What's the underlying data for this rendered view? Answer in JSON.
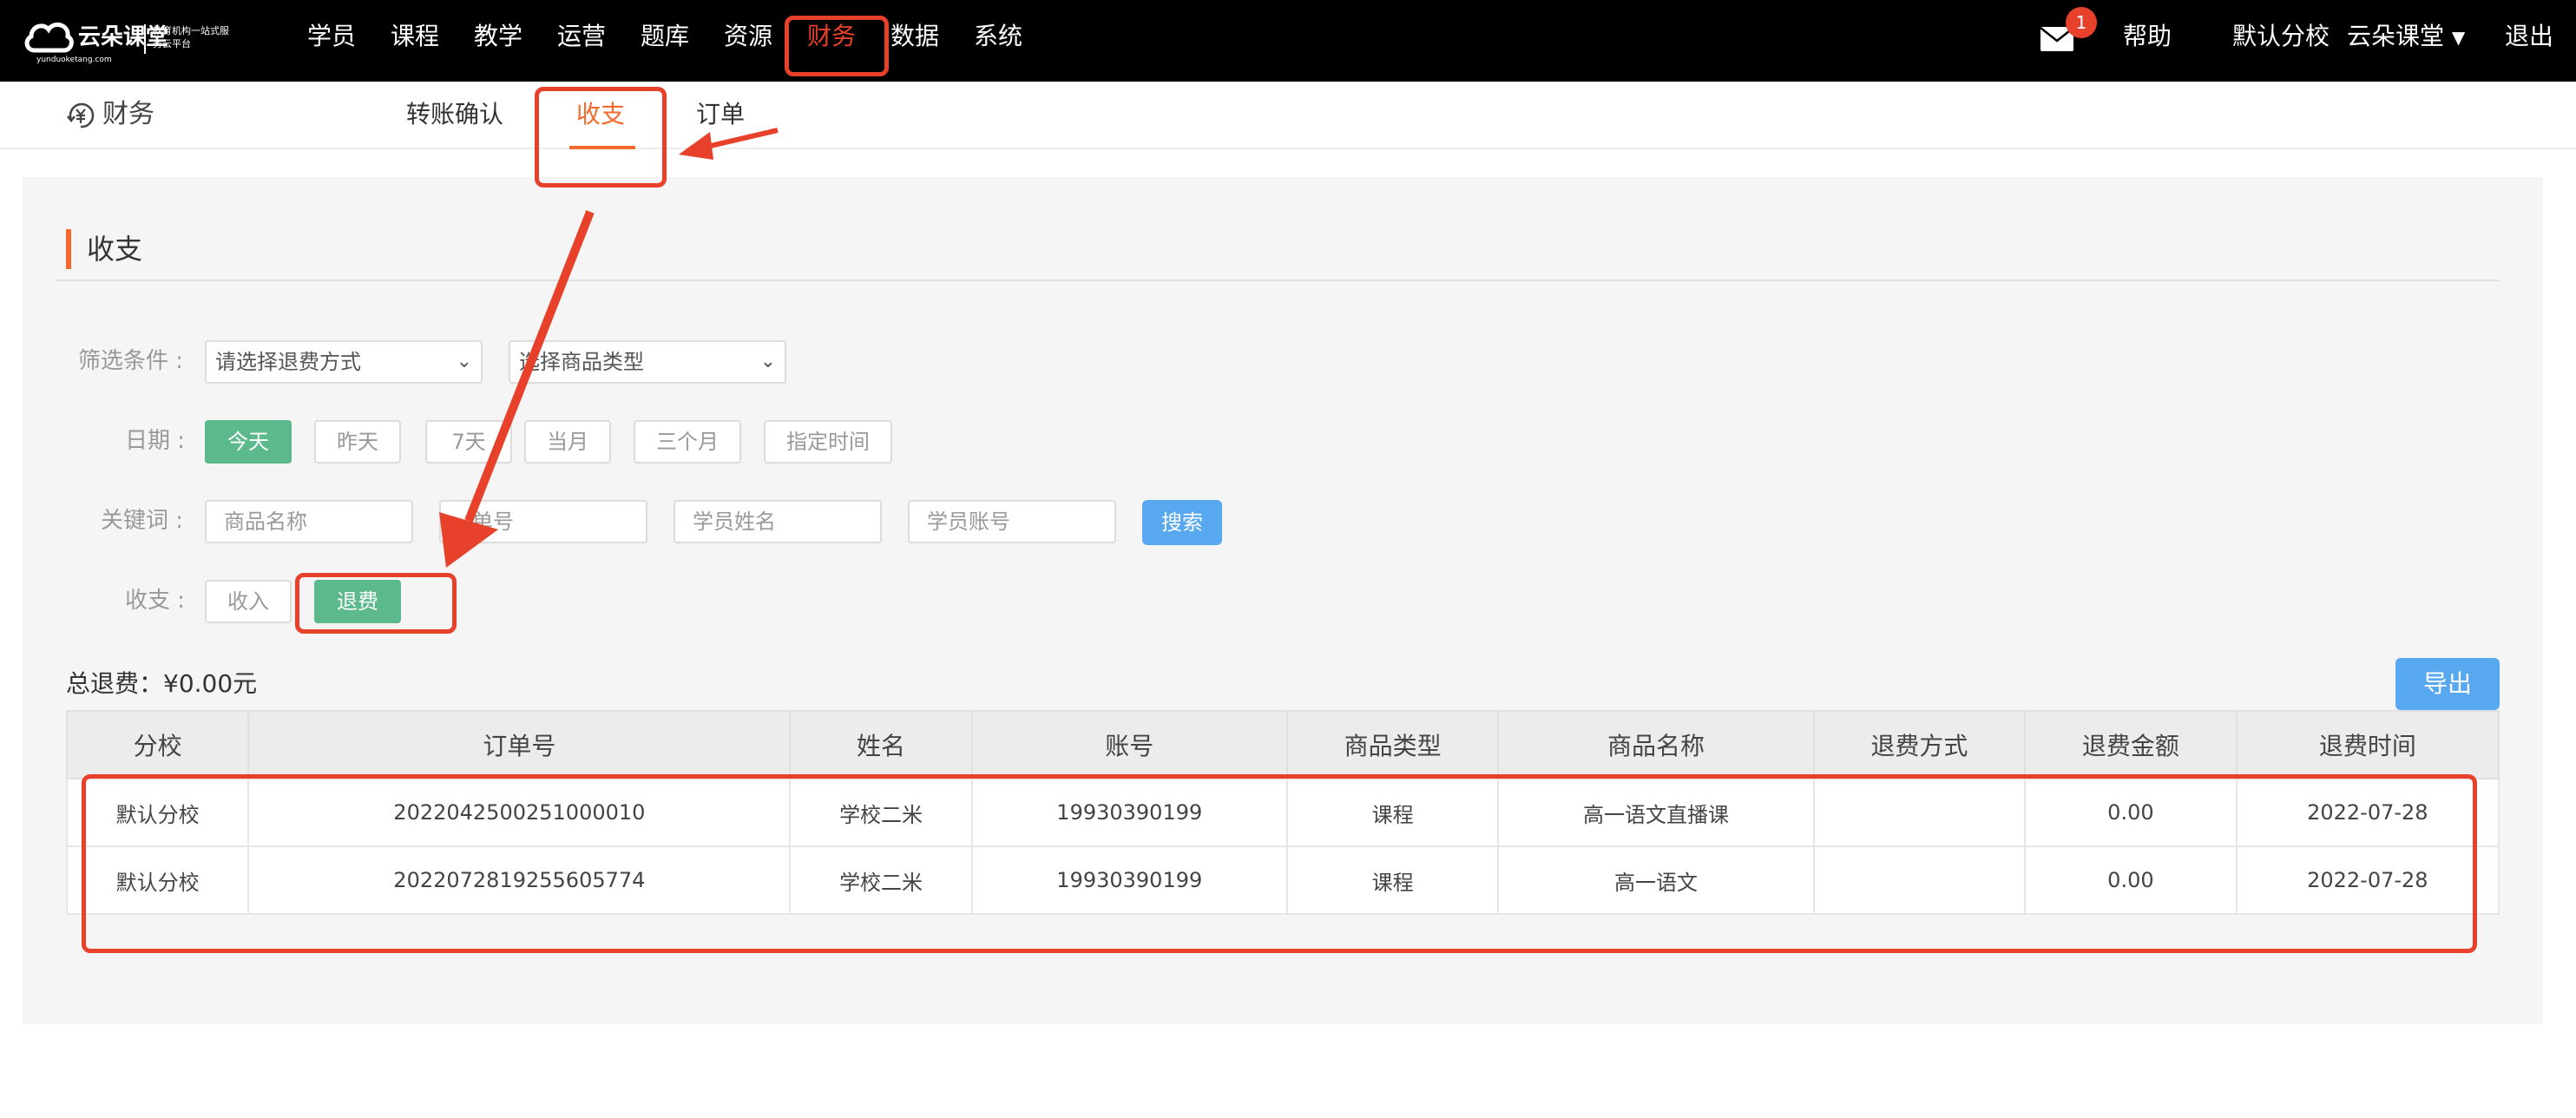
{
  "topbar": {
    "logo": {
      "brand": "云朵课堂",
      "domain": "yunduoketang.com",
      "slogan": "教育机构一站式服务云平台"
    },
    "nav": [
      "学员",
      "课程",
      "教学",
      "运营",
      "题库",
      "资源",
      "财务",
      "数据",
      "系统"
    ],
    "active_nav": "财务",
    "mail_badge": "1",
    "help": "帮助",
    "school": "默认分校",
    "user": "云朵课堂",
    "logout": "退出"
  },
  "subnav": {
    "title": "财务",
    "tabs": [
      "转账确认",
      "收支",
      "订单"
    ],
    "active_tab": "收支"
  },
  "section": {
    "title": "收支"
  },
  "filters": {
    "conditions_label": "筛选条件 :",
    "refund_method_select": "请选择退费方式",
    "product_type_select": "选择商品类型",
    "date_label": "日期 :",
    "date_options": [
      "今天",
      "昨天",
      "7天",
      "当月",
      "三个月",
      "指定时间"
    ],
    "active_date": "今天",
    "keyword_label": "关键词 :",
    "keyword_inputs": [
      "商品名称",
      "单号",
      "学员姓名",
      "学员账号"
    ],
    "search_button": "搜索",
    "type_label": "收支 :",
    "type_options": [
      "收入",
      "退费"
    ],
    "active_type": "退费"
  },
  "summary": {
    "total_refund": "总退费：¥0.00元",
    "export_button": "导出"
  },
  "table": {
    "headers": [
      "分校",
      "订单号",
      "姓名",
      "账号",
      "商品类型",
      "商品名称",
      "退费方式",
      "退费金额",
      "退费时间"
    ],
    "rows": [
      [
        "默认分校",
        "2022042500251000010",
        "学校二米",
        "19930390199",
        "课程",
        "高一语文直播课",
        "",
        "0.00",
        "2022-07-28"
      ],
      [
        "默认分校",
        "2022072819255605774",
        "学校二米",
        "19930390199",
        "课程",
        "高一语文",
        "",
        "0.00",
        "2022-07-28"
      ]
    ]
  },
  "colors": {
    "accent_orange": "#f26a2e",
    "annotation_red": "#e8412b",
    "green": "#5cb98c",
    "blue": "#57a8ef"
  }
}
